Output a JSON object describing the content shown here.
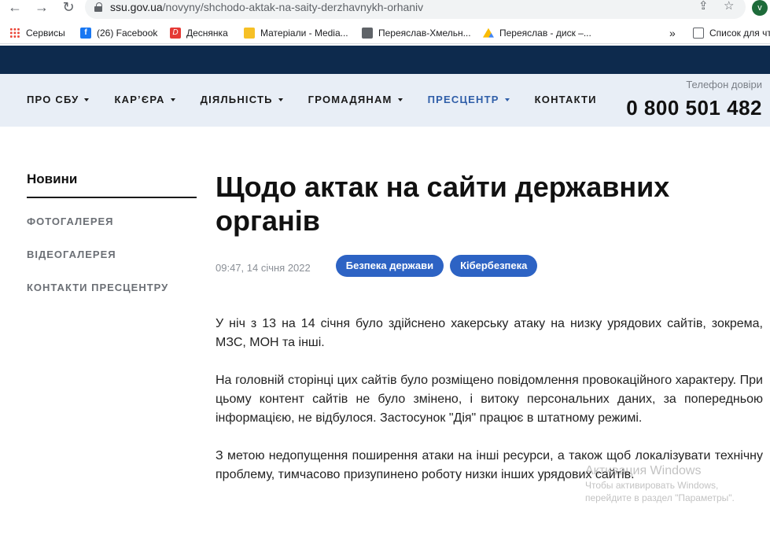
{
  "browser": {
    "url_host": "ssu.gov.ua",
    "url_path": "/novyny/shchodo-aktak-na-saity-derzhavnykh-orhaniv",
    "profile_initial": "v",
    "bookmarks": [
      {
        "label": "Сервисы",
        "icon": "apps-icon"
      },
      {
        "label": "(26) Facebook",
        "icon": "facebook-icon"
      },
      {
        "label": "Деснянка",
        "icon": "desnianka-icon"
      },
      {
        "label": "Матеріали - Media...",
        "icon": "media-icon"
      },
      {
        "label": "Переяслав-Хмельн...",
        "icon": "globe-icon"
      },
      {
        "label": "Переяслав - диск –...",
        "icon": "google-drive-icon"
      }
    ],
    "more_bookmarks": "»",
    "reading_list": "Список для чт"
  },
  "header": {
    "menu": [
      {
        "label": "ПРО СБУ",
        "dropdown": true
      },
      {
        "label": "КАР’ЄРА",
        "dropdown": true
      },
      {
        "label": "ДІЯЛЬНІСТЬ",
        "dropdown": true
      },
      {
        "label": "ГРОМАДЯНАМ",
        "dropdown": true
      },
      {
        "label": "ПРЕСЦЕНТР",
        "dropdown": true,
        "active": true
      },
      {
        "label": "КОНТАКТИ",
        "dropdown": false
      }
    ],
    "hotline_label": "Телефон довіри",
    "hotline_number": "0 800 501 482"
  },
  "sidebar": {
    "title": "Новини",
    "links": [
      "ФОТОГАЛЕРЕЯ",
      "ВІДЕОГАЛЕРЕЯ",
      "КОНТАКТИ ПРЕСЦЕНТРУ"
    ]
  },
  "article": {
    "title": "Щодо актак на сайти державних органів",
    "date": "09:47, 14 січня 2022",
    "tags": [
      "Безпека держави",
      "Кібербезпека"
    ],
    "paragraphs": [
      "У ніч з 13 на 14 січня було здійснено хакерську атаку на низку урядових сайтів, зокрема, МЗС, МОН та інші.",
      "На головній сторінці цих сайтів було розміщено повідомлення провокаційного характеру. При цьому контент сайтів не було змінено, і витоку персональних даних, за попередньою інформацією, не відбулося. Застосунок \"Дія\" працює в штатному режимі.",
      "З метою недопущення поширення атаки на інші ресурси, а також щоб локалізувати технічну проблему, тимчасово призупинено роботу низки інших урядових сайтів."
    ]
  },
  "watermark": {
    "line1": "Активация Windows",
    "line2": "Чтобы активировать Windows,",
    "line3": "перейдите в раздел \"Параметры\"."
  },
  "colors": {
    "topbar": "#0d2a4d",
    "menubar": "#e8eef6",
    "accent": "#2f5ea8",
    "tag": "#2d63c4"
  }
}
